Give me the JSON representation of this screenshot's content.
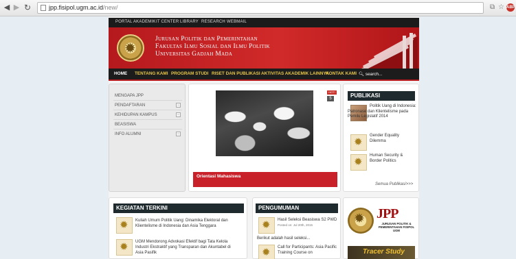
{
  "browser": {
    "url_host": "jpp.fisipol.ugm.ac.id",
    "url_path": "/new/",
    "back_icon": "arrow-left",
    "forward_icon": "arrow-right",
    "reload_icon": "reload",
    "abp_label": "ABP"
  },
  "topbar": {
    "links": [
      "PORTAL AKADEMIK",
      "IT CENTER",
      "LIBRARY",
      "RESEARCH",
      "WEBMAIL"
    ]
  },
  "header": {
    "line1": "Jurusan Politik dan Pemerintahan",
    "line2": "Fakultas Ilmu Sosial dan Ilmu Politik",
    "line3": "Universitas Gadjah Mada"
  },
  "nav": {
    "items": [
      "HOME",
      "TENTANG KAMI",
      "PROGRAM STUDI",
      "RISET DAN PUBLIKASI",
      "AKTIVITAS AKADEMIK LAINNYA",
      "KONTAK KAMI"
    ],
    "search_label": "search..."
  },
  "sidebar": {
    "items": [
      "MENGAPA JPP",
      "PENDAFTARAN",
      "KEHIDUPAN KAMPUS",
      "BEASISWA",
      "INFO ALUMNI"
    ],
    "toggle_symbol": "−"
  },
  "slider": {
    "hot_label": "HOT!",
    "count": "5",
    "caption": "Orientasi Mahasiswa"
  },
  "publikasi": {
    "title": "PUBLIKASI",
    "entries": [
      "Politik Uang di Indonesia: Patronase dan Klientelisme pada Pemilu Legislatif 2014",
      "Gender Equality Dilemma",
      "Human Security & Border Politics"
    ],
    "more": "Semua Publikasi>>>"
  },
  "kegiatan": {
    "title": "KEGIATAN TERKINI",
    "items": [
      "Kuliah Umum Politik Uang: Dinamika Elektoral dan Klientelisme di Indonesia dan Asia Tenggara",
      "UGM Mendorong Advokasi Efektif bagi Tata Kelola Industri Ekstraktif yang Transparan dan Akuntabel di Asia Pasifik"
    ]
  },
  "pengumuman": {
    "title": "PENGUMUMAN",
    "item1_title": "Hasil Seleksi Beasiswa S2 PWD",
    "item1_posted": "Posted on: Jul 20th, 2015",
    "item1_excerpt": "Berikut adalah hasil seleksi...",
    "item2_title": "Call for Participants: Asia Pacific Training Course on"
  },
  "logo": {
    "jpp": "JPP",
    "sub": "JURUSAN POLITIK & PEMERINTAHAN FISIPOL UGM",
    "tracer": "Tracer Study"
  }
}
